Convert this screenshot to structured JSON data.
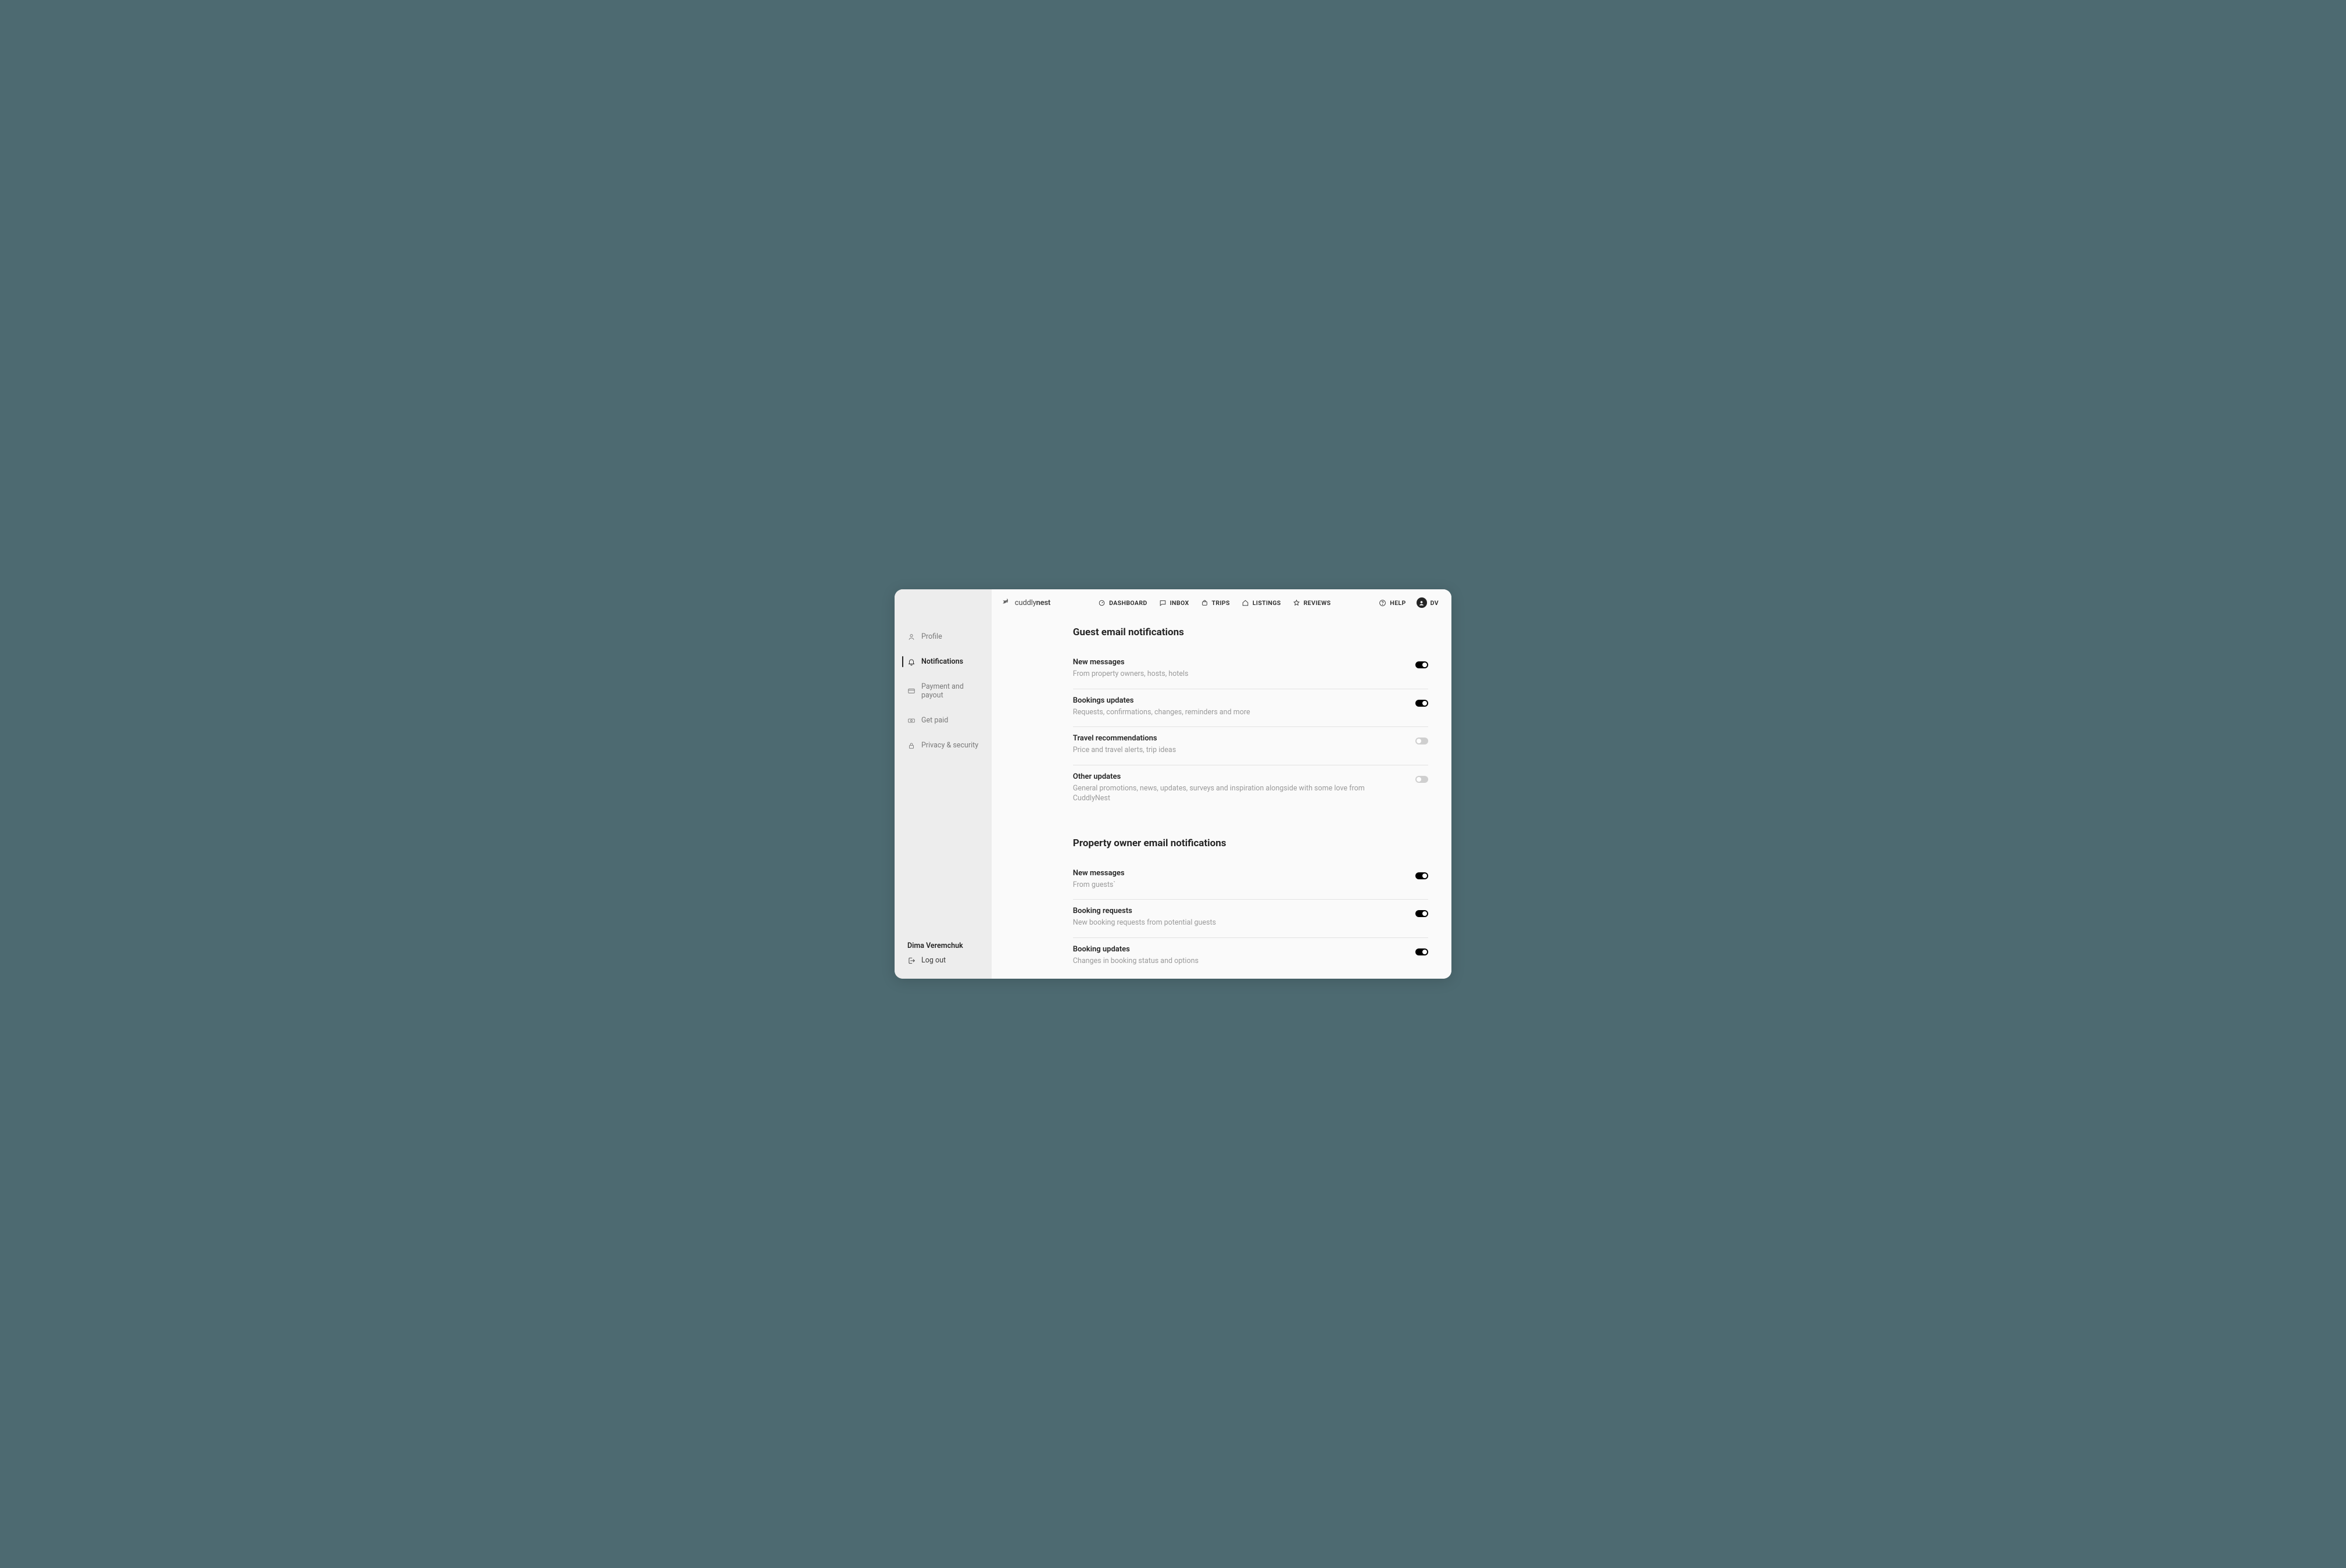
{
  "brand": {
    "name_part1": "cuddly",
    "name_part2": "nest"
  },
  "topnav": {
    "dashboard": "DASHBOARD",
    "inbox": "INBOX",
    "trips": "TRIPS",
    "listings": "LISTINGS",
    "reviews": "REVIEWS",
    "help": "HELP",
    "initials": "DV"
  },
  "sidebar": {
    "items": {
      "profile": "Profile",
      "notifications": "Notifications",
      "payment": "Payment and payout",
      "getpaid": "Get paid",
      "privacy": "Privacy & security"
    },
    "user_name": "Dima Veremchuk",
    "logout": "Log out"
  },
  "sections": {
    "guest": {
      "title": "Guest email notifications",
      "rows": {
        "new_messages": {
          "title": "New messages",
          "desc": "From property owners, hosts, hotels",
          "on": true
        },
        "bookings_updates": {
          "title": "Bookings updates",
          "desc": "Requests, confirmations, changes, reminders and more",
          "on": true
        },
        "travel_recs": {
          "title": "Travel recommendations",
          "desc": "Price and travel alerts, trip ideas",
          "on": false
        },
        "other_updates": {
          "title": "Other updates",
          "desc": "General promotions, news, updates, surveys and inspiration alongside with some love from CuddlyNest",
          "on": false
        }
      }
    },
    "owner": {
      "title": "Property owner email notifications",
      "rows": {
        "new_messages": {
          "title": "New messages",
          "desc": "From guests`",
          "on": true
        },
        "booking_requests": {
          "title": "Booking requests",
          "desc": "New booking requests from potential guests",
          "on": true
        },
        "booking_updates": {
          "title": "Booking updates",
          "desc": "Changes in booking status and options",
          "on": true
        }
      }
    }
  }
}
